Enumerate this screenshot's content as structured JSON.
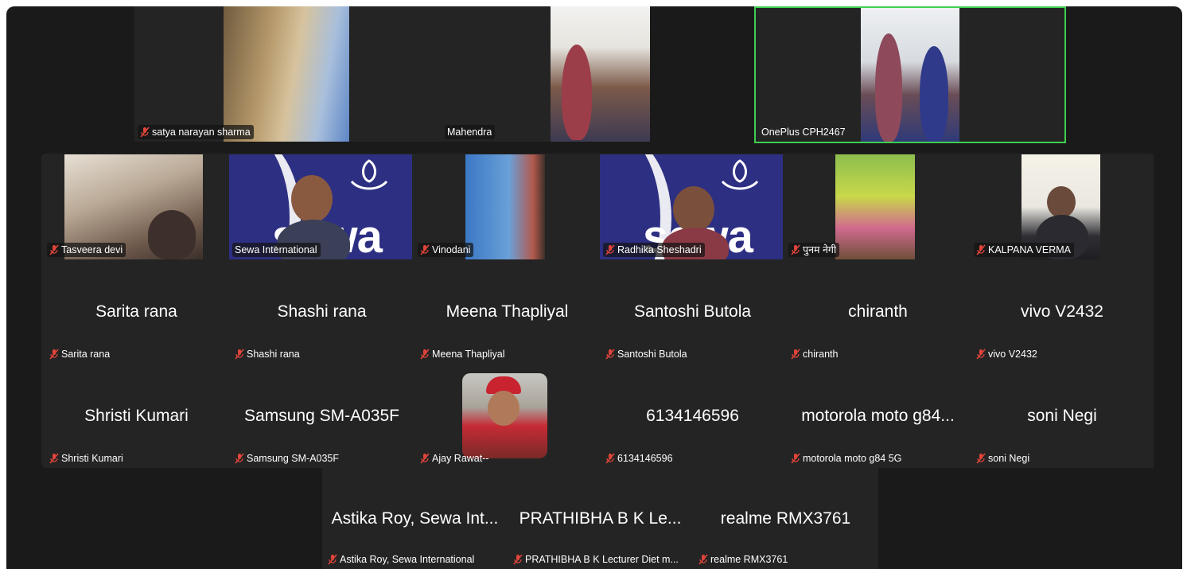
{
  "colors": {
    "background": "#1a1a1a",
    "tile": "#242424",
    "active_border": "#3ecf4f",
    "muted_icon": "#e0443a",
    "brand": "#2d2f82"
  },
  "row1": [
    {
      "label": "satya narayan sharma",
      "muted": true,
      "video": true
    },
    {
      "label": "Mahendra",
      "muted": false,
      "video": true
    },
    {
      "label": "OnePlus CPH2467",
      "muted": false,
      "video": true,
      "active_speaker": true
    }
  ],
  "row2": [
    {
      "label": "Tasveera devi",
      "muted": true,
      "video": true
    },
    {
      "label": "Sewa International",
      "muted": false,
      "video": true,
      "logo_text": "sewa"
    },
    {
      "label": "Vinodani",
      "muted": true,
      "video": true
    },
    {
      "label": "Radhika Sheshadri",
      "muted": true,
      "video": true,
      "logo_text": "sewa"
    },
    {
      "label": "पुनम नेगी",
      "muted": true,
      "video": true
    },
    {
      "label": "KALPANA VERMA",
      "muted": true,
      "video": true
    }
  ],
  "row3": [
    {
      "name": "Sarita rana",
      "label": "Sarita rana",
      "muted": true
    },
    {
      "name": "Shashi rana",
      "label": "Shashi rana",
      "muted": true
    },
    {
      "name": "Meena Thapliyal",
      "label": "Meena Thapliyal",
      "muted": true
    },
    {
      "name": "Santoshi Butola",
      "label": "Santoshi Butola",
      "muted": true
    },
    {
      "name": "chiranth",
      "label": "chiranth",
      "muted": true
    },
    {
      "name": "vivo V2432",
      "label": "vivo V2432",
      "muted": true
    }
  ],
  "row4": [
    {
      "name": "Shristi Kumari",
      "label": "Shristi Kumari",
      "muted": true
    },
    {
      "name": "Samsung SM-A035F",
      "label": "Samsung SM-A035F",
      "muted": true
    },
    {
      "name": "",
      "label": "Ajay Rawat--",
      "muted": true,
      "avatar": true
    },
    {
      "name": "6134146596",
      "label": "6134146596",
      "muted": true
    },
    {
      "name": "motorola moto g84...",
      "label": "motorola moto g84 5G",
      "muted": true
    },
    {
      "name": "soni Negi",
      "label": "soni Negi",
      "muted": true
    }
  ],
  "row5": [
    {
      "name": "Astika Roy, Sewa Int...",
      "label": "Astika Roy, Sewa International",
      "muted": true
    },
    {
      "name": "PRATHIBHA B K  Le...",
      "label": "PRATHIBHA B K  Lecturer Diet m...",
      "muted": true
    },
    {
      "name": "realme RMX3761",
      "label": "realme RMX3761",
      "muted": true
    }
  ],
  "icons": {
    "muted": "mic-muted-icon"
  }
}
